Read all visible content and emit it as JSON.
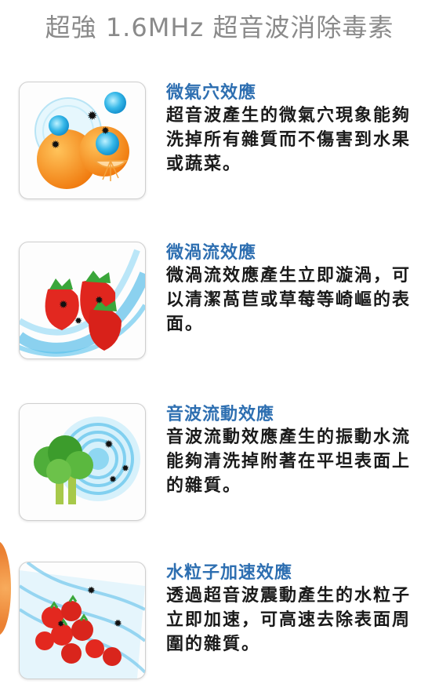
{
  "title": "超強 1.6MHz 超音波消除毒素",
  "features": [
    {
      "heading": "微氣穴效應",
      "body": "超音波產生的微氣穴現象能夠洗掉所有雜質而不傷害到水果或蔬菜。",
      "icon": "oranges-bubbles-icon"
    },
    {
      "heading": "微渦流效應",
      "body": "微渦流效應產生立即漩渦，可以清潔萵苣或草莓等崎嶇的表面。",
      "icon": "strawberries-vortex-icon"
    },
    {
      "heading": "音波流動效應",
      "body": "音波流動效應產生的振動水流能夠清洗掉附著在平坦表面上的雜質。",
      "icon": "broccoli-soundwave-icon"
    },
    {
      "heading": "水粒子加速效應",
      "body": "透過超音波震動產生的水粒子立即加速，可高速去除表面周圍的雜質。",
      "icon": "tomatoes-water-icon"
    }
  ]
}
